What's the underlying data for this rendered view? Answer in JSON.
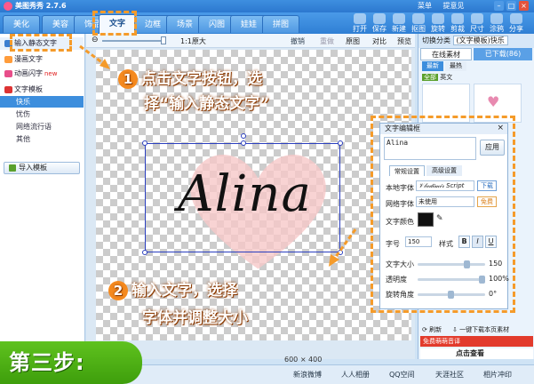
{
  "app": {
    "title": "美图秀秀 2.7.6",
    "menu": "菜单",
    "feedback": "提意见"
  },
  "tabs": [
    "美化",
    "美容",
    "饰品",
    "文字",
    "边框",
    "场景",
    "闪图",
    "娃娃",
    "拼图"
  ],
  "active_tab": "文字",
  "toolbar": [
    "打开",
    "保存",
    "新建",
    "抠图",
    "旋转",
    "剪裁",
    "尺寸",
    "涂鸦",
    "分享"
  ],
  "left_panel": {
    "items": [
      "输入静态文字",
      "漫画文字",
      "动画闪字",
      "文字模板"
    ],
    "new_badge": "new",
    "subitems": [
      "快乐",
      "忧伤",
      "网络流行语",
      "其他"
    ],
    "import_btn": "导入模板"
  },
  "zoom": {
    "label": "1:1原大"
  },
  "actions": {
    "undo": "撤销",
    "redo": "重做",
    "original": "原图",
    "compare": "对比",
    "preview": "预览"
  },
  "canvas": {
    "text": "Alina",
    "size": "600 × 400"
  },
  "right_panel": {
    "category_label": "切换分类",
    "category_value": "(文字模板)快乐",
    "tab_online": "在线素材",
    "tab_downloaded": "已下载(86)",
    "subtab_latest": "最新",
    "subtab_hot": "最热",
    "filter_all": "全部",
    "filter_en": "英文",
    "refresh": "刷新",
    "download_more": "一键下载本页素材",
    "promo": "免费萌萌音译",
    "promo2": "点击查看"
  },
  "dialog": {
    "title": "文字编辑框",
    "input_value": "Alina",
    "apply_btn": "应用",
    "tabs": [
      "常规设置",
      "高级设置"
    ],
    "local_font_label": "本地字体",
    "local_font_value": "𝒱𝓁𝒶𝒹𝒾𝓂𝒾𝓇 Script",
    "download_btn": "下载",
    "web_font_label": "网络字体",
    "web_font_value": "未使用",
    "free_btn": "免费",
    "color_label": "文字颜色",
    "size_label": "字号",
    "size_value": "150",
    "style_label": "样式",
    "bold": "B",
    "italic": "I",
    "underline": "U",
    "slider_size_label": "文字大小",
    "slider_size_value": "150",
    "opacity_label": "透明度",
    "opacity_value": "100%",
    "rotation_label": "旋转角度",
    "rotation_value": "0°"
  },
  "annotations": {
    "step1": "点击文字按钮，选",
    "step1_line2": "择“输入静态文字”",
    "step2": "输入文字，选择",
    "step2_line2": "字体并调整大小",
    "step1_num": "1",
    "step2_num": "2",
    "step3": "第三步:"
  },
  "statusbar": [
    "新浪微博",
    "人人相册",
    "QQ空间",
    "天涯社区",
    "相片冲印"
  ],
  "colors": {
    "accent": "#2f7fd4",
    "orange": "#f58a1f",
    "green": "#4aa914",
    "text_color": "#111111"
  }
}
